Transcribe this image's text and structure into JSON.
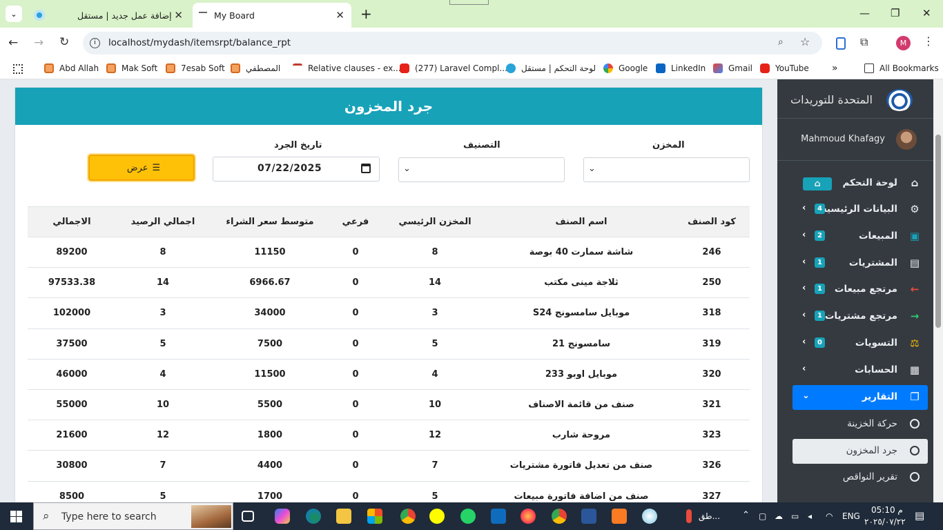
{
  "browser": {
    "tabs": [
      {
        "title": "إضافة عمل جديد | مستقل",
        "active": false
      },
      {
        "title": "My Board",
        "active": true
      }
    ],
    "url": "localhost/mydash/itemsrpt/balance_rpt",
    "bookmarks": [
      "Abd Allah",
      "Mak Soft",
      "7esab Soft",
      "المصطفي",
      "Relative clauses - ex...",
      "(277) Laravel Compl...",
      "لوحة التحكم | مستقل",
      "Google",
      "LinkedIn",
      "Gmail",
      "YouTube"
    ],
    "all_bookmarks": "All Bookmarks"
  },
  "report": {
    "title": "جرد المخزون",
    "filters": {
      "store_label": "المخزن",
      "category_label": "التصنيف",
      "date_label": "تاريخ الجرد",
      "date_value": "07/22/2025",
      "show_button": "عرض"
    },
    "columns": [
      "كود الصنف",
      "اسم الصنف",
      "المخزن الرئيسي",
      "فرعي",
      "متوسط سعر الشراء",
      "اجمالي الرصيد",
      "الاجمالي"
    ],
    "rows": [
      [
        "246",
        "شاشة سمارت 40 بوصة",
        "8",
        "0",
        "11150",
        "8",
        "89200"
      ],
      [
        "250",
        "ثلاجة مينى مكتب",
        "14",
        "0",
        "6966.67",
        "14",
        "97533.38"
      ],
      [
        "318",
        "موبايل سامسونج S24",
        "3",
        "0",
        "34000",
        "3",
        "102000"
      ],
      [
        "319",
        "سامسونج 21",
        "5",
        "0",
        "7500",
        "5",
        "37500"
      ],
      [
        "320",
        "موبايل اوبو 233",
        "4",
        "0",
        "11500",
        "4",
        "46000"
      ],
      [
        "321",
        "صنف من قائمة الاصناف",
        "10",
        "0",
        "5500",
        "10",
        "55000"
      ],
      [
        "323",
        "مروحة شارب",
        "12",
        "0",
        "1800",
        "12",
        "21600"
      ],
      [
        "326",
        "صنف من تعديل فاتورة مشتريات",
        "7",
        "0",
        "4400",
        "7",
        "30800"
      ],
      [
        "327",
        "صنف من اضافة فاتورة مبيعات",
        "5",
        "0",
        "1700",
        "5",
        "8500"
      ]
    ]
  },
  "sidebar": {
    "brand": "المتحدة للتوريدات",
    "user": "Mahmoud Khafagy",
    "items": [
      {
        "label": "لوحة التحكم",
        "icon": "home-icon",
        "badge": ""
      },
      {
        "label": "البيانات الرئيسية",
        "icon": "gears-icon",
        "badge": "4"
      },
      {
        "label": "المبيعات",
        "icon": "shopping-bag-icon",
        "badge": "2"
      },
      {
        "label": "المشتريات",
        "icon": "table-icon",
        "badge": "1"
      },
      {
        "label": "مرتجع مبيعات",
        "icon": "arrow-left-icon",
        "badge": "1"
      },
      {
        "label": "مرتجع مشتريات",
        "icon": "arrow-right-icon",
        "badge": "1"
      },
      {
        "label": "التسويات",
        "icon": "scale-icon",
        "badge": "0"
      },
      {
        "label": "الحسابات",
        "icon": "calculator-icon",
        "badge": ""
      },
      {
        "label": "التقارير",
        "icon": "copy-icon",
        "badge": ""
      }
    ],
    "subitems": [
      "حركة الخزينة",
      "جرد المخزون",
      "تقرير النواقص"
    ]
  },
  "taskbar": {
    "search_placeholder": "Type here to search",
    "weather": "طق...",
    "lang": "ENG",
    "time": "05:10 م",
    "date": "٢٠٢٥/٠٧/٢٢"
  },
  "colors": {
    "header": "#17a2b8",
    "sidebar": "#343a40",
    "show_button": "#ffc107",
    "active_nav": "#007bff"
  }
}
